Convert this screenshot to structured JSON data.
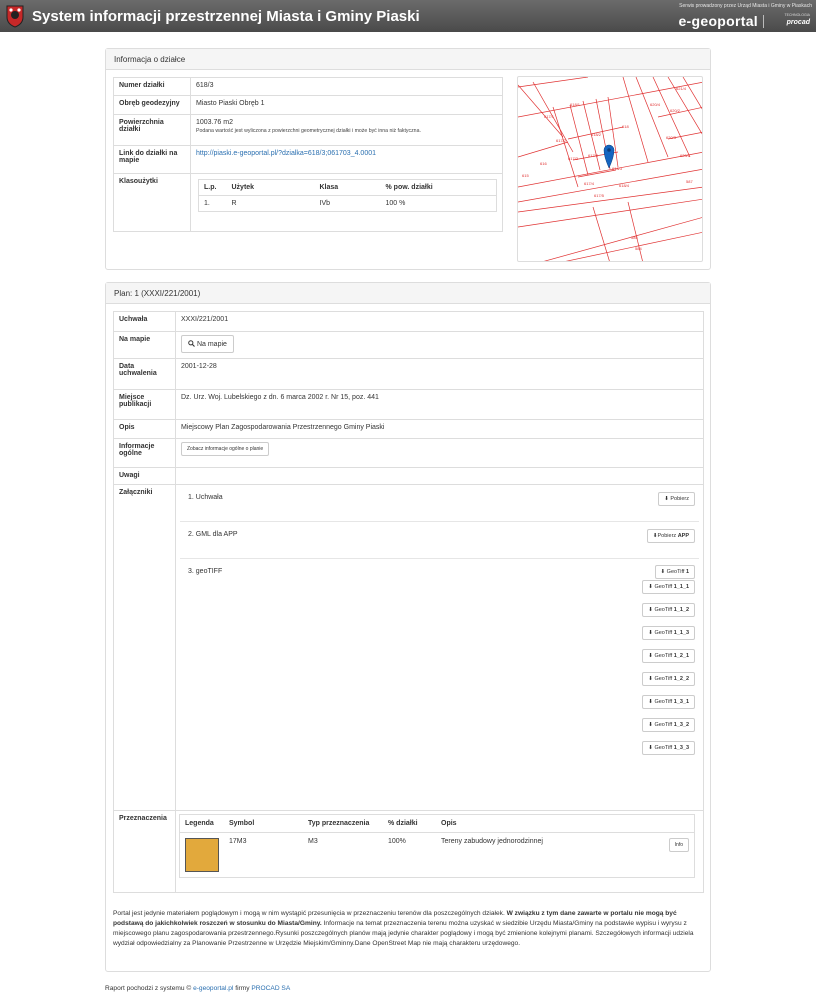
{
  "header": {
    "title": "System informacji przestrzennej Miasta i Gminy Piaski",
    "service": "Serwis prowadzony przez Urząd Miasta i Gminy w Piaskach",
    "brand": "e-geoportal",
    "tech_label": "TECHNOLOGIA",
    "tech_brand": "procad"
  },
  "parcel": {
    "heading": "Informacja o działce",
    "rows": {
      "numer_label": "Numer działki",
      "numer": "618/3",
      "obreb_label": "Obręb geodezyjny",
      "obreb": "Miasto Piaski Obręb 1",
      "pow_label": "Powierzchnia działki",
      "pow": "1003.76 m2",
      "pow_note": "Podana wartość jest wyliczona z powierzchni geometrycznej działki i może być inna niż faktyczna.",
      "link_label": "Link do działki na mapie",
      "link": "http://piaski.e-geoportal.pl/?dzialka=618/3;061703_4.0001",
      "klas_label": "Klasoużytki"
    },
    "klas_headers": [
      "L.p.",
      "Użytek",
      "Klasa",
      "% pow. działki"
    ],
    "klas_rows": [
      [
        "1.",
        "R",
        "IVb",
        "100 %"
      ]
    ]
  },
  "map_labels": [
    "621/4",
    "618/1",
    "620/4",
    "620/2",
    "617/1",
    "618",
    "617/2",
    "618/2",
    "620/3",
    "616",
    "617/3",
    "617/4",
    "618/3",
    "620/1",
    "615",
    "587",
    "617/4",
    "618/4",
    "617/5",
    "585",
    "584"
  ],
  "plan": {
    "heading": "Plan: 1 (XXXI/221/2001)",
    "uchwala_label": "Uchwała",
    "uchwala": "XXXI/221/2001",
    "na_mapie_label": "Na mapie",
    "na_mapie_btn": "Na mapie",
    "data_label": "Data uchwalenia",
    "data": "2001-12-28",
    "miejsce_label": "Miejsce publikacji",
    "miejsce": "Dz. Urz. Woj. Lubelskiego z dn. 6 marca 2002 r. Nr 15, poz. 441",
    "opis_label": "Opis",
    "opis": "Miejscowy Plan Zagospodarowania Przestrzennego Gminy Piaski",
    "info_label": "Informacje ogólne",
    "info_btn": "Zobacz informacje ogólne o planie",
    "uwagi_label": "Uwagi",
    "zal_label": "Załączniki",
    "attachments": [
      {
        "name": "1.   Uchwała",
        "btns": [
          {
            "prefix": "Pobierz",
            "bold": ""
          }
        ]
      },
      {
        "name": "2.   GML dla APP",
        "btns": [
          {
            "prefix": "Pobierz",
            "bold": "APP"
          }
        ]
      },
      {
        "name": "3.   geoTIFF",
        "btns": [
          {
            "prefix": "GeoTiff",
            "bold": "1"
          },
          {
            "prefix": "GeoTiff",
            "bold": "1_1_1"
          },
          {
            "prefix": "GeoTiff",
            "bold": "1_1_2"
          },
          {
            "prefix": "GeoTiff",
            "bold": "1_1_3"
          },
          {
            "prefix": "GeoTiff",
            "bold": "1_2_1"
          },
          {
            "prefix": "GeoTiff",
            "bold": "1_2_2"
          },
          {
            "prefix": "GeoTiff",
            "bold": "1_3_1"
          },
          {
            "prefix": "GeoTiff",
            "bold": "1_3_2"
          },
          {
            "prefix": "GeoTiff",
            "bold": "1_3_3"
          }
        ]
      }
    ],
    "prz_label": "Przeznaczenia",
    "prz_headers": [
      "Legenda",
      "Symbol",
      "Typ przeznaczenia",
      "% działki",
      "Opis",
      ""
    ],
    "prz_rows": [
      {
        "color": "#e2a93c",
        "symbol": "17M3",
        "typ": "M3",
        "pct": "100%",
        "opis": "Tereny zabudowy jednorodzinnej",
        "btn": "Info"
      }
    ]
  },
  "disclaimer": {
    "part1": "Portal jest jedynie materiałem poglądowym i mogą w nim wystąpić przesunięcia w przeznaczeniu terenów dla poszczególnych działek.",
    "bold": "W związku z tym dane zawarte w portalu nie mogą być podstawą do jakichkolwiek roszczeń w stosunku do Miasta/Gminy.",
    "part2": "Informacje na temat przeznaczenia terenu można uzyskać w siedzibie Urzędu Miasta/Gminy na podstawie wypisu i wyrysu z miejscowego planu zagospodarowania przestrzennego.Rysunki poszczególnych planów mają jedynie charakter poglądowy i mogą być zmienione kolejnymi planami. Szczegółowych informacji udziela wydział odpowiedzialny za Planowanie Przestrzenne w Urzędzie Miejskim/Gminny.Dane OpenStreet Map nie mają charakteru urzędowego."
  },
  "footer": {
    "prefix": "Raport pochodzi z systemu ©",
    "link1": "e-geoportal.pl",
    "mid": "firmy",
    "link2": "PROCAD SA"
  },
  "colors": {
    "map_lines": "#e03131",
    "marker": "#1565c0",
    "accent_link": "#2a6fb0"
  }
}
